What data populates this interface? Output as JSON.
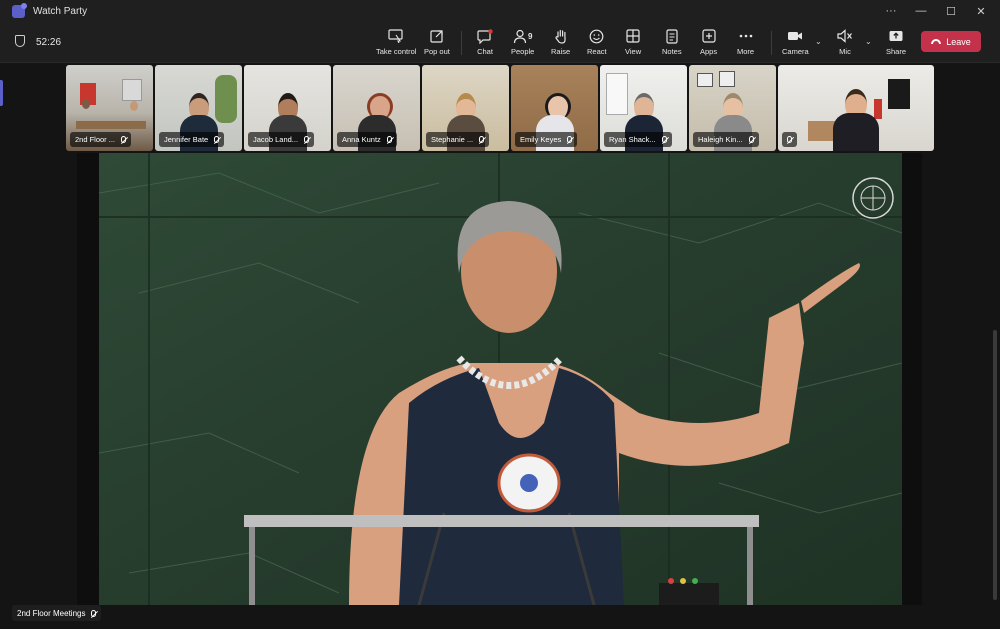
{
  "window": {
    "title": "Watch Party",
    "minimize": "—",
    "maximize": "☐",
    "close": "✕",
    "more": "···"
  },
  "meeting": {
    "timer": "52:26"
  },
  "toolbar": {
    "take_control": "Take control",
    "pop_out": "Pop out",
    "chat": "Chat",
    "people": "People",
    "people_count": "9",
    "raise": "Raise",
    "react": "React",
    "view": "View",
    "notes": "Notes",
    "apps": "Apps",
    "more": "More",
    "camera": "Camera",
    "mic": "Mic",
    "share": "Share",
    "leave": "Leave"
  },
  "participants": [
    {
      "name": "2nd Floor ...",
      "muted": true
    },
    {
      "name": "Jennifer Bate",
      "muted": true
    },
    {
      "name": "Jacob Land...",
      "muted": true
    },
    {
      "name": "Anna Kuntz",
      "muted": true
    },
    {
      "name": "Stephanie ...",
      "muted": true
    },
    {
      "name": "Emily Keyes",
      "muted": true
    },
    {
      "name": "Ryan Shack...",
      "muted": true
    },
    {
      "name": "Haleigh Kin...",
      "muted": true
    },
    {
      "name": "",
      "muted": true
    }
  ],
  "stage": {
    "source_name": "2nd Floor Meetings",
    "muted": true
  },
  "colors": {
    "leave": "#c4314b",
    "brand": "#5b5fc7",
    "chat_badge": "#e3372e"
  }
}
